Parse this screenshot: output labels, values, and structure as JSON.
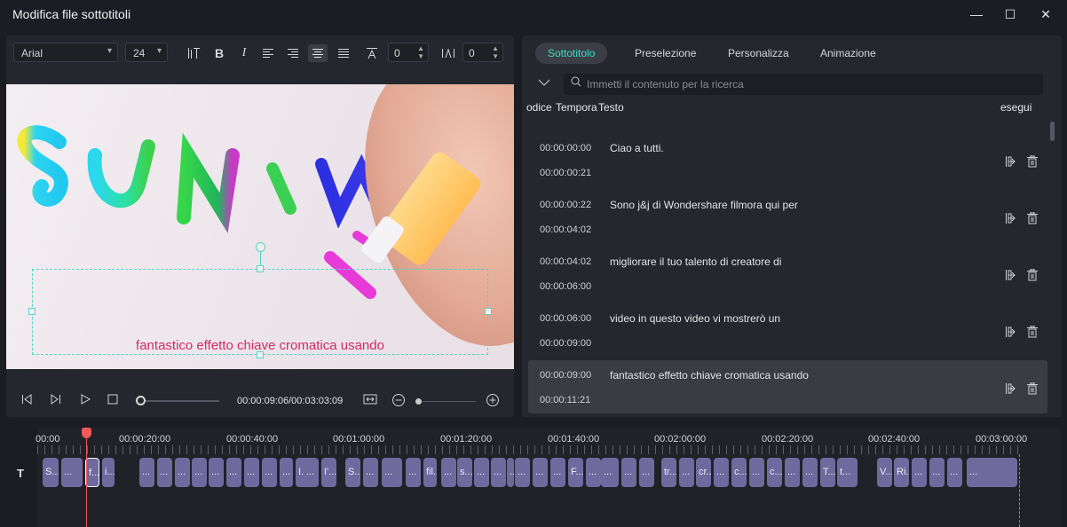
{
  "window": {
    "title": "Modifica file sottotitoli",
    "minimize": "—",
    "maximize": "☐",
    "close": "✕"
  },
  "toolbar": {
    "font": "Arial",
    "size": "24",
    "icons": [
      "text-spacing-icon",
      "bold-icon",
      "italic-icon",
      "align-left-icon",
      "align-right-icon",
      "align-center-icon",
      "align-justify-icon",
      "text-background-icon",
      "letter-spacing-icon"
    ],
    "bold": "B",
    "italic": "I",
    "opacity_value": "0",
    "spacing_value": "0"
  },
  "preview": {
    "caption": "fantastico effetto chiave cromatica usando",
    "caption_color": "#d02c64"
  },
  "playback": {
    "timecode": "00:00:09:06/00:03:03:09"
  },
  "tabs": [
    {
      "label": "Sottotitolo",
      "active": true
    },
    {
      "label": "Preselezione",
      "active": false
    },
    {
      "label": "Personalizza",
      "active": false
    },
    {
      "label": "Animazione",
      "active": false
    }
  ],
  "search": {
    "placeholder": "Immetti il contenuto per la ricerca"
  },
  "columns": {
    "codice": "odice",
    "tempo": "Tempora",
    "testo": "Testo",
    "esegui": "esegui"
  },
  "subtitles": [
    {
      "start": "00:00:00:00",
      "end": "00:00:00:21",
      "text": "Ciao a tutti.",
      "selected": false
    },
    {
      "start": "00:00:00:22",
      "end": "00:00:04:02",
      "text": "Sono j&j di Wondershare filmora qui per",
      "selected": false
    },
    {
      "start": "00:00:04:02",
      "end": "00:00:06:00",
      "text": "migliorare il tuo talento di creatore di",
      "selected": false
    },
    {
      "start": "00:00:06:00",
      "end": "00:00:09:00",
      "text": "video in questo video vi mostrerò un",
      "selected": false
    },
    {
      "start": "00:00:09:00",
      "end": "00:00:11:21",
      "text": "fantastico effetto chiave cromatica usando",
      "selected": true
    }
  ],
  "timeline": {
    "ruler": [
      "00:00",
      "00:00:20:00",
      "00:00:40:00",
      "00:01:00:00",
      "00:01:20:00",
      "00:01:40:00",
      "00:02:00:00",
      "00:02:20:00",
      "00:02:40:00",
      "00:03:00:00"
    ],
    "clip_labels": [
      "S...",
      "...",
      "f...",
      "i...",
      "...",
      "...",
      "...",
      "...",
      "...",
      "...",
      "...",
      "...",
      "...",
      "I...",
      "...",
      "I'...",
      "S...",
      "...",
      "...",
      "...",
      "fil...",
      "...",
      "s...",
      "...",
      "...",
      "...",
      "...",
      "...",
      "...",
      "F...",
      "...",
      "...",
      "...",
      "...",
      "tr...",
      "...",
      "cr...",
      "...",
      "c...",
      "...",
      "c...",
      "...",
      "...",
      "T...",
      "t...",
      "V...",
      "Ri...",
      "...",
      "...",
      "...",
      "...",
      "...",
      "...",
      ""
    ],
    "track_icon": "T",
    "clip_color": "#6f6a9e"
  }
}
